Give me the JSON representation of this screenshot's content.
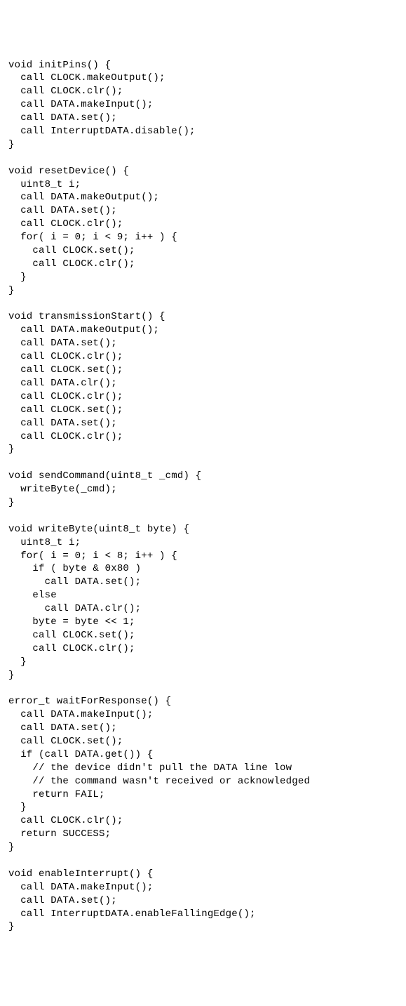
{
  "code": {
    "functions": [
      {
        "signature": "void initPins() {",
        "body": [
          "  call CLOCK.makeOutput();",
          "  call CLOCK.clr();",
          "  call DATA.makeInput();",
          "  call DATA.set();",
          "  call InterruptDATA.disable();"
        ],
        "close": "}"
      },
      {
        "signature": "void resetDevice() {",
        "body": [
          "  uint8_t i;",
          "  call DATA.makeOutput();",
          "  call DATA.set();",
          "  call CLOCK.clr();",
          "  for( i = 0; i < 9; i++ ) {",
          "    call CLOCK.set();",
          "    call CLOCK.clr();",
          "  }"
        ],
        "close": "}"
      },
      {
        "signature": "void transmissionStart() {",
        "body": [
          "  call DATA.makeOutput();",
          "  call DATA.set();",
          "  call CLOCK.clr();",
          "  call CLOCK.set();",
          "  call DATA.clr();",
          "  call CLOCK.clr();",
          "  call CLOCK.set();",
          "  call DATA.set();",
          "  call CLOCK.clr();"
        ],
        "close": "}"
      },
      {
        "signature": "void sendCommand(uint8_t _cmd) {",
        "body": [
          "  writeByte(_cmd);"
        ],
        "close": "}"
      },
      {
        "signature": "void writeByte(uint8_t byte) {",
        "body": [
          "  uint8_t i;",
          "  for( i = 0; i < 8; i++ ) {",
          "    if ( byte & 0x80 )",
          "      call DATA.set();",
          "    else",
          "      call DATA.clr();",
          "    byte = byte << 1;",
          "    call CLOCK.set();",
          "    call CLOCK.clr();",
          "  }"
        ],
        "close": "}"
      },
      {
        "signature": "error_t waitForResponse() {",
        "body": [
          "  call DATA.makeInput();",
          "  call DATA.set();",
          "  call CLOCK.set();",
          "  if (call DATA.get()) {",
          "    // the device didn't pull the DATA line low",
          "    // the command wasn't received or acknowledged",
          "    return FAIL;",
          "  }",
          "  call CLOCK.clr();",
          "  return SUCCESS;"
        ],
        "close": "}"
      },
      {
        "signature": "void enableInterrupt() {",
        "body": [
          "  call DATA.makeInput();",
          "  call DATA.set();",
          "  call InterruptDATA.enableFallingEdge();"
        ],
        "close": "}"
      }
    ]
  }
}
